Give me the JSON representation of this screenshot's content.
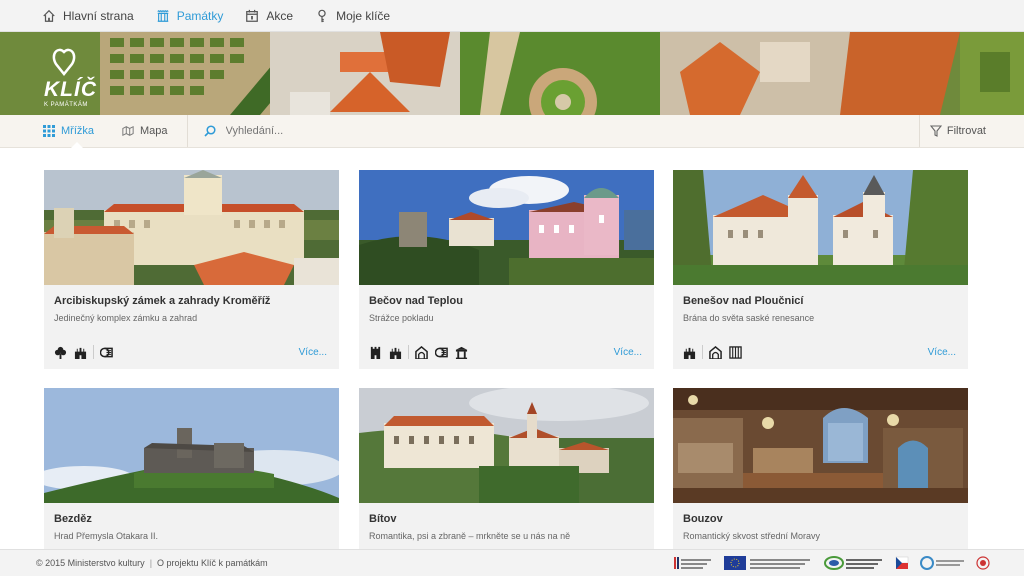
{
  "nav": {
    "items": [
      {
        "label": "Hlavní strana",
        "icon": "home-icon",
        "active": false
      },
      {
        "label": "Památky",
        "icon": "monument-icon",
        "active": true
      },
      {
        "label": "Akce",
        "icon": "calendar-icon",
        "active": false
      },
      {
        "label": "Moje klíče",
        "icon": "key-icon",
        "active": false
      }
    ]
  },
  "logo": {
    "text": "KLÍČ",
    "tagline": "K PAMÁTKÁM"
  },
  "toolbar": {
    "grid_label": "Mřížka",
    "map_label": "Mapa",
    "search_placeholder": "Vyhledání...",
    "filter_label": "Filtrovat"
  },
  "cards": [
    {
      "title": "Arcibiskupský zámek a zahrady Kroměříž",
      "subtitle": "Jedinečný komplex zámku a zahrad",
      "more": "Více...",
      "icons": [
        "garden-icon",
        "castle-icon",
        "sep",
        "scroll-icon"
      ]
    },
    {
      "title": "Bečov nad Teplou",
      "subtitle": "Strážce pokladu",
      "more": "Více...",
      "icons": [
        "tower-icon",
        "castle-icon",
        "sep",
        "arch-icon",
        "scroll-icon",
        "temple-icon"
      ]
    },
    {
      "title": "Benešov nad Ploučnicí",
      "subtitle": "Brána do světa saské renesance",
      "more": "Více...",
      "icons": [
        "castle-icon",
        "sep",
        "arch-icon",
        "columns-icon"
      ]
    },
    {
      "title": "Bezděz",
      "subtitle": "Hrad Přemysla Otakara II.",
      "more": "",
      "icons": []
    },
    {
      "title": "Bítov",
      "subtitle": "Romantika, psi a zbraně – mrkněte se u nás na ně",
      "more": "",
      "icons": []
    },
    {
      "title": "Bouzov",
      "subtitle": "Romantický skvost střední Moravy",
      "more": "",
      "icons": []
    }
  ],
  "footer": {
    "copyright": "© 2015 Ministerstvo kultury",
    "separator": "|",
    "about": "O projektu Klíč k památkám"
  },
  "colors": {
    "accent": "#2f9bd7",
    "card_bg": "#f2f2f2",
    "toolbar_bg": "#f7f4ef"
  }
}
